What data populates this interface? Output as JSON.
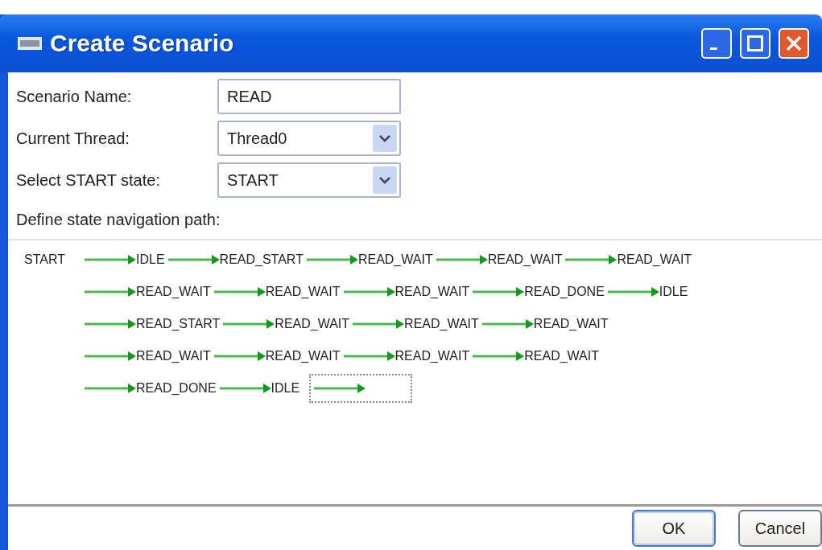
{
  "window": {
    "title": "Create Scenario"
  },
  "form": [
    {
      "kind": "text",
      "label": "Scenario Name:",
      "value": "READ"
    },
    {
      "kind": "select",
      "label": "Current Thread:",
      "value": "Thread0"
    },
    {
      "kind": "select",
      "label": "Select START state:",
      "value": "START"
    }
  ],
  "path_label": "Define state navigation path:",
  "path": {
    "start": "START",
    "rows": [
      [
        "IDLE",
        "READ_START",
        "READ_WAIT",
        "READ_WAIT",
        "READ_WAIT"
      ],
      [
        "READ_WAIT",
        "READ_WAIT",
        "READ_WAIT",
        "READ_DONE",
        "IDLE"
      ],
      [
        "READ_START",
        "READ_WAIT",
        "READ_WAIT",
        "READ_WAIT"
      ],
      [
        "READ_WAIT",
        "READ_WAIT",
        "READ_WAIT",
        "READ_WAIT"
      ],
      [
        "READ_DONE",
        "IDLE"
      ]
    ],
    "pending_slot": true
  },
  "buttons": [
    "OK",
    "Cancel"
  ]
}
